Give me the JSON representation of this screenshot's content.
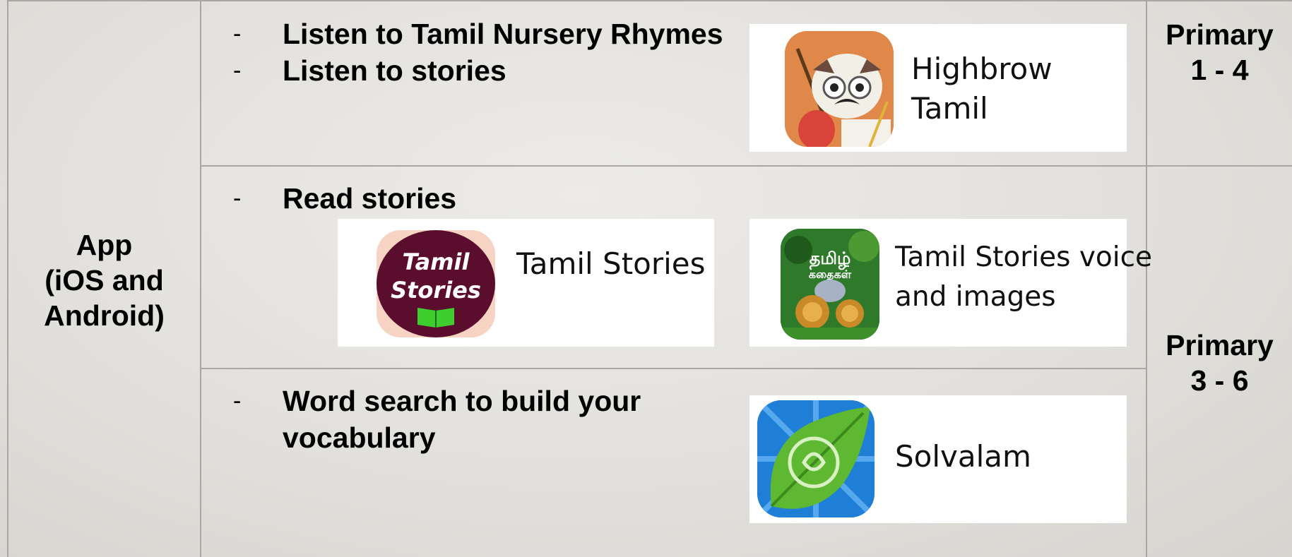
{
  "left_cell": {
    "line1": "App",
    "line2": "(iOS and",
    "line3": "Android)"
  },
  "rows": [
    {
      "bullets": [
        "Listen to Tamil Nursery Rhymes",
        "Listen to stories"
      ],
      "apps": [
        {
          "name": "Highbrow Tamil",
          "icon": "owl-veena-app-icon"
        }
      ]
    },
    {
      "bullets": [
        "Read stories"
      ],
      "apps": [
        {
          "name": "Tamil Stories",
          "icon_text_1": "Tamil",
          "icon_text_2": "Stories",
          "icon": "book-app-icon"
        },
        {
          "name_line1": "Tamil Stories voice",
          "name_line2": "and images",
          "icon_text_1": "தமிழ்",
          "icon_text_2": "கதைகள்",
          "icon": "jungle-animals-app-icon"
        }
      ]
    },
    {
      "bullets": [
        "Word search to build your",
        "vocabulary"
      ],
      "apps": [
        {
          "name": "Solvalam",
          "icon": "green-leaf-app-icon"
        }
      ]
    }
  ],
  "levels": [
    {
      "line1": "Primary",
      "line2": "1 - 4"
    },
    {
      "line1": "Primary",
      "line2": "3 - 6"
    }
  ],
  "dash": "-",
  "colors": {
    "background": "#e2e0dc",
    "grid": "#a9a7a3",
    "card": "#ffffff"
  }
}
